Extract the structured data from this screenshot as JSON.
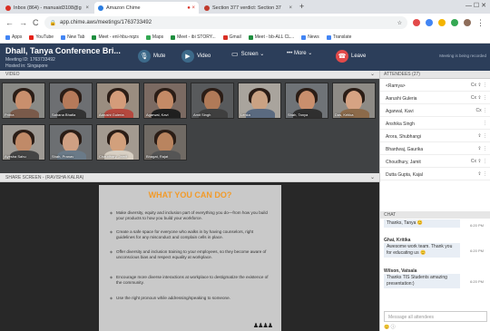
{
  "browser": {
    "tabs": [
      {
        "label": "Inbox (864) - manuaid3108@g",
        "active": false,
        "color": "#d93025"
      },
      {
        "label": "Amazon Chime",
        "active": true,
        "color": "#2a7de1"
      },
      {
        "label": "Section 377 verdict: Section 37",
        "active": false,
        "color": "#c0392b"
      }
    ],
    "new_tab": "+",
    "url": "app.chime.aws/meetings/1763733492",
    "bookmarks": [
      {
        "label": "Apps",
        "color": "#4285f4"
      },
      {
        "label": "YouTube",
        "color": "#e62117"
      },
      {
        "label": "New Tab",
        "color": "#4285f4"
      },
      {
        "label": "Meet - enl-hbu-nqzs",
        "color": "#1e8e3e"
      },
      {
        "label": "Maps",
        "color": "#34a853"
      },
      {
        "label": "Meet - ibi STORY...",
        "color": "#1e8e3e"
      },
      {
        "label": "Gmail",
        "color": "#d93025"
      },
      {
        "label": "Meet - bb-ALL CL...",
        "color": "#1e8e3e"
      },
      {
        "label": "News",
        "color": "#4285f4"
      },
      {
        "label": "Translate",
        "color": "#4285f4"
      }
    ]
  },
  "meeting": {
    "title": "Dhall, Tanya Conference Bri...",
    "meeting_id": "Meeting ID: 1763733492",
    "hosted_in": "Hosted in: Singapore",
    "buttons": {
      "mute": "Mute",
      "video": "Video",
      "screen": "Screen ⌄",
      "more": "••• More ⌄",
      "leave": "Leave"
    },
    "status": "Meeting is being recorded"
  },
  "video": {
    "label": "VIDEO",
    "participants": [
      {
        "name": "Pritha",
        "skin": "#c98f6d",
        "shirt": "#7a5a4a",
        "bg": "#8a8a86"
      },
      {
        "name": "Sahana Bhatla",
        "skin": "#b57a5a",
        "shirt": "#333333",
        "bg": "#6d6f72"
      },
      {
        "name": "Aarushi Guleria",
        "skin": "#d49c7a",
        "shirt": "#b5483e",
        "bg": "#9a8d80"
      },
      {
        "name": "Agarwal, Kavi",
        "skin": "#c48a66",
        "shirt": "#1f1f1f",
        "bg": "#7b6a62"
      },
      {
        "name": "Amit Singh",
        "skin": "#b07a58",
        "shirt": "#3f3f3f",
        "bg": "#585a5c"
      },
      {
        "name": "Lenka",
        "skin": "#caa283",
        "shirt": "#5a6a80",
        "bg": "#a9a49d"
      },
      {
        "name": "Shah, Tanya",
        "skin": "#c98f6d",
        "shirt": "#2f2f2f",
        "bg": "#6f7377"
      },
      {
        "name": "Das, Kritika",
        "skin": "#d6a383",
        "shirt": "#8c6a4a",
        "bg": "#8e8b86"
      },
      {
        "name": "Ayesha Sahu",
        "skin": "#c08a68",
        "shirt": "#444444",
        "bg": "#9e9a94"
      },
      {
        "name": "Shah, Pranav",
        "skin": "#cfa083",
        "shirt": "#6a7a88",
        "bg": "#6c6f72"
      },
      {
        "name": "Chaudhary, Jamit",
        "skin": "#d2a07c",
        "shirt": "#d8d0c4",
        "bg": "#a39a90"
      },
      {
        "name": "Bhagat, Rajat",
        "skin": "#b9845f",
        "shirt": "#555555",
        "bg": "#706a64"
      }
    ]
  },
  "share": {
    "label": "SHARE SCREEN - (RAVISHA KALRA)",
    "slide_title": "WHAT YOU CAN DO?",
    "bullets": [
      "Make diversity, equity and inclusion part of everything you do—from how you build your products to how you build your workforce.",
      "Create a safe space for everyone who walks in by having counselors, right guidelines for any misconduct and complain cells in place.",
      "Offer diversity and inclusion training to your employees, so they become aware of unconscious bias and respect equality at workplace.",
      "Encourage more diverse interactions at workplace to destigmatize the existence of the community.",
      "Use the right pronoun while addressing/speaking to someone."
    ],
    "figures": "♟♟♟♟"
  },
  "attendees": {
    "label": "ATTENDEES (27)",
    "list": [
      {
        "name": "<Ramya>",
        "icons": "Cx ⇪ ⋮"
      },
      {
        "name": "Aarushi Guleria",
        "icons": "Cx ⇪ ⋮"
      },
      {
        "name": "Agarwal, Kavi",
        "icons": "Cx ⋮"
      },
      {
        "name": "Anshika Singh",
        "icons": "⋮"
      },
      {
        "name": "Arora, Shubhangi",
        "icons": "⇪ ⋮"
      },
      {
        "name": "Bhardwaj, Gaurika",
        "icons": "⇪ ⋮"
      },
      {
        "name": "Choudhury, Jamit",
        "icons": "Cx ⇪ ⋮"
      },
      {
        "name": "Dutta Gupta, Kajal",
        "icons": "⇪ ⋮"
      }
    ]
  },
  "chat": {
    "label": "CHAT",
    "messages": [
      {
        "name": "",
        "text": "Thanks, Tanya 😊",
        "time": "6:20 PM"
      },
      {
        "name": "Ghai, Kritika",
        "text": "Awesome work team. Thank you for educating us 😊",
        "time": "6:20 PM"
      },
      {
        "name": "Wilson, Vatsala",
        "text": "Thanks TIS Students amazing presentation:)",
        "time": "6:20 PM"
      }
    ],
    "input_placeholder": "Message all attendees",
    "footer": "😊 ⓘ"
  }
}
